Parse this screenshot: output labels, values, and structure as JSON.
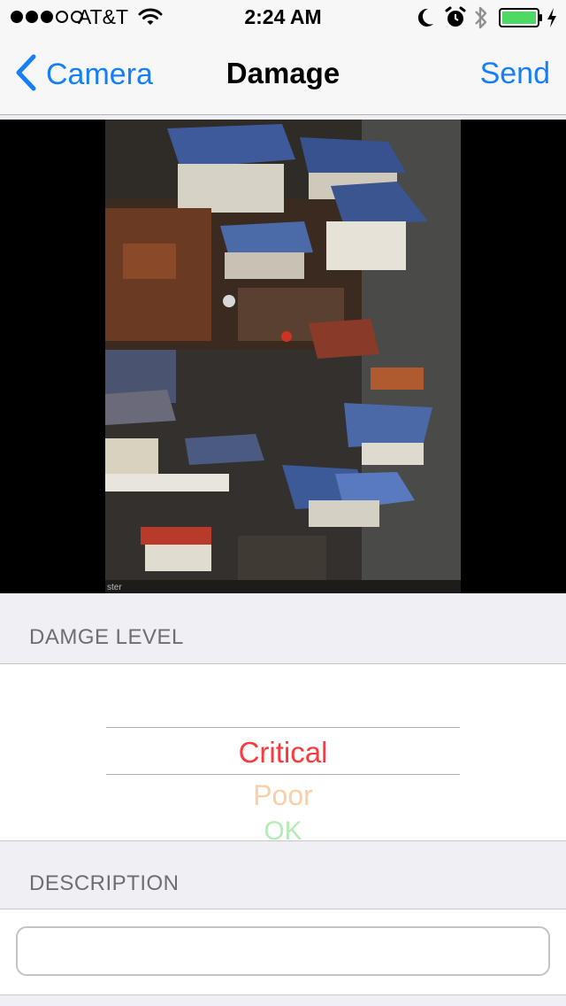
{
  "status_bar": {
    "signal_bars": 5,
    "signal_filled": 3,
    "carrier": "AT&T",
    "time": "2:24 AM",
    "icons": [
      "wifi-icon",
      "moon-icon",
      "alarm-icon",
      "bluetooth-icon",
      "battery-icon",
      "charging-bolt-icon"
    ],
    "battery_color": "#4cd964"
  },
  "nav": {
    "back_label": "Camera",
    "title": "Damage",
    "send_label": "Send",
    "accent_color": "#157efb"
  },
  "photo": {
    "description_icon": "damage-photo",
    "caption": "ster"
  },
  "damage_level": {
    "header": "DAMGE LEVEL",
    "options": [
      {
        "label": "Critical",
        "color": "#fa3a3d"
      },
      {
        "label": "Poor",
        "color": "#fbcfa6"
      },
      {
        "label": "OK",
        "color": "#b3ecb6"
      }
    ],
    "selected": "Critical"
  },
  "description": {
    "header": "DESCRIPTION",
    "value": "",
    "placeholder": ""
  }
}
